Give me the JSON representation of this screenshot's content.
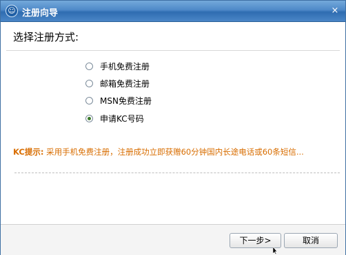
{
  "window": {
    "title": "注册向导",
    "close_label": "×"
  },
  "main": {
    "section_title": "选择注册方式:",
    "options": [
      {
        "label": "手机免费注册",
        "checked": false
      },
      {
        "label": "邮箱免费注册",
        "checked": false
      },
      {
        "label": "MSN免费注册",
        "checked": false
      },
      {
        "label": "申请KC号码",
        "checked": true
      }
    ],
    "tip": {
      "label": "KC提示:",
      "text": "采用手机免费注册，注册成功立即获赠60分钟国内长途电话或60条短信..."
    }
  },
  "footer": {
    "next_label": "下一步>",
    "cancel_label": "取消"
  },
  "colors": {
    "titlebar": "#4e89c8",
    "tip": "#d86d00"
  }
}
